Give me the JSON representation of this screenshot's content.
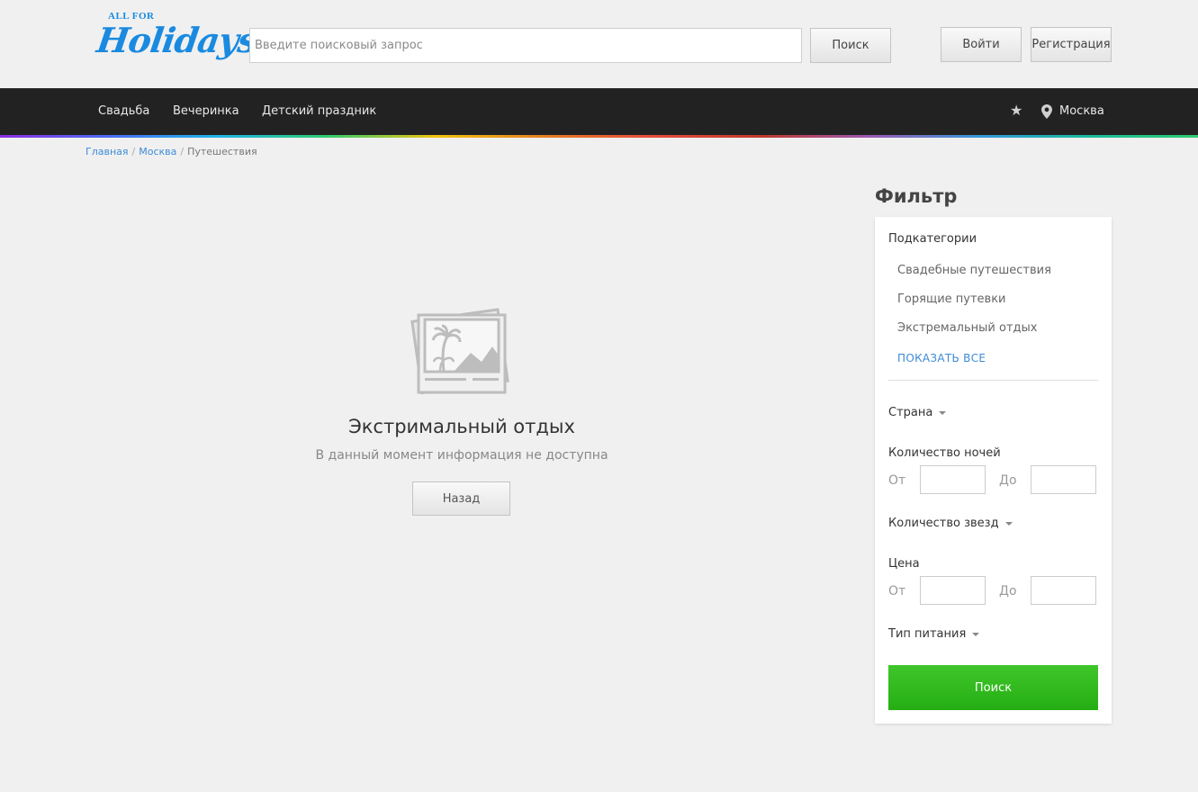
{
  "header": {
    "logo_top": "ALL FOR",
    "logo_main": "Holidays",
    "search_placeholder": "Введите поисковый запрос",
    "search_button": "Поиск",
    "login_button": "Войти",
    "register_button": "Регистрация"
  },
  "nav": {
    "items": [
      "Свадьба",
      "Вечеринка",
      "Детский праздник"
    ],
    "city": "Москва"
  },
  "breadcrumb": [
    "Главная",
    "Москва",
    "Путешествия"
  ],
  "empty": {
    "title": "Экстримальный отдых",
    "description": "В данный момент информация не доступна",
    "back_button": "Назад"
  },
  "filter": {
    "title": "Фильтр",
    "subcategories_label": "Подкатегории",
    "subcategories": [
      "Свадебные путешествия",
      "Горящие путевки",
      "Экстремальный отдых"
    ],
    "show_all": "ПОКАЗАТЬ ВСЕ",
    "country_label": "Страна",
    "nights_label": "Количество ночей",
    "from_label": "От",
    "to_label": "До",
    "stars_label": "Количество звезд",
    "price_label": "Цена",
    "meal_label": "Тип питания",
    "search_button": "Поиск"
  },
  "colors": {
    "accent_blue": "#3d8bd6",
    "nav_bg": "#222222",
    "search_green": "#2bb51a"
  }
}
